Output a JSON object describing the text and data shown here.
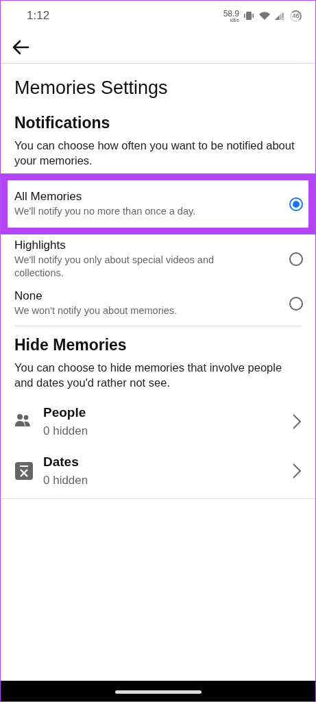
{
  "status_bar": {
    "time": "1:12",
    "speed": "58.9",
    "speed_unit": "kB/s",
    "battery": "46"
  },
  "title": "Memories Settings",
  "notifications": {
    "heading": "Notifications",
    "description": "You can choose how often you want to be notified about your memories.",
    "options": [
      {
        "label": "All Memories",
        "detail": "We'll notify you no more than once a day.",
        "selected": true,
        "highlighted": true
      },
      {
        "label": "Highlights",
        "detail": "We'll notify you only about special videos and collections.",
        "selected": false,
        "highlighted": false
      },
      {
        "label": "None",
        "detail": "We won't notify you about memories.",
        "selected": false,
        "highlighted": false
      }
    ]
  },
  "hide_memories": {
    "heading": "Hide Memories",
    "description": "You can choose to hide memories that involve people and dates you'd rather not see.",
    "items": [
      {
        "kind": "people",
        "label": "People",
        "count": "0 hidden"
      },
      {
        "kind": "dates",
        "label": "Dates",
        "count": "0 hidden"
      }
    ]
  }
}
